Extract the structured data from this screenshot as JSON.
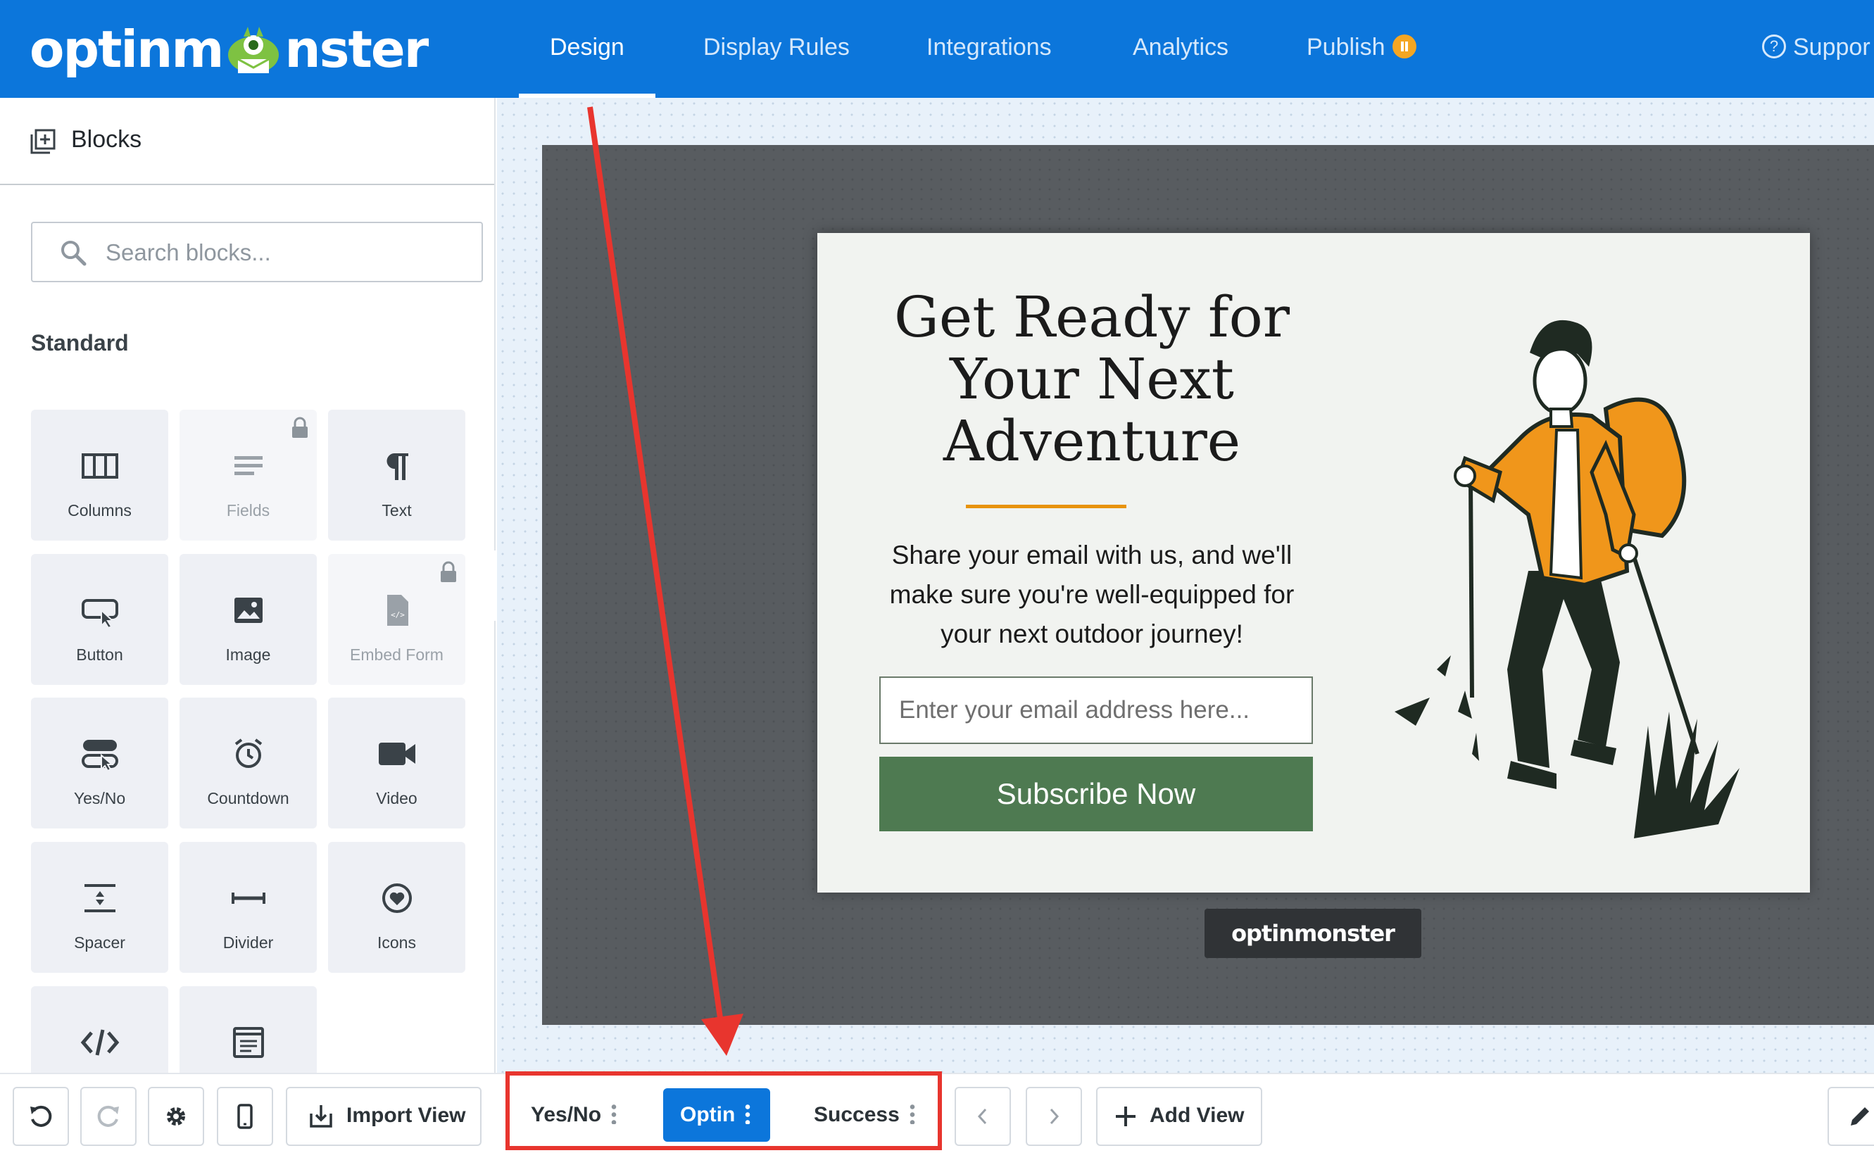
{
  "app": {
    "logo_text_left": "optinm",
    "logo_text_right": "nster"
  },
  "nav": {
    "design": "Design",
    "display_rules": "Display Rules",
    "integrations": "Integrations",
    "analytics": "Analytics",
    "publish": "Publish",
    "support": "Suppor",
    "active": "Design"
  },
  "sidebar": {
    "title": "Blocks",
    "search_placeholder": "Search blocks...",
    "section": "Standard",
    "blocks": [
      {
        "label": "Columns",
        "icon": "columns-icon",
        "locked": false
      },
      {
        "label": "Fields",
        "icon": "fields-icon",
        "locked": true
      },
      {
        "label": "Text",
        "icon": "paragraph-icon",
        "locked": false
      },
      {
        "label": "Button",
        "icon": "button-icon",
        "locked": false
      },
      {
        "label": "Image",
        "icon": "image-icon",
        "locked": false
      },
      {
        "label": "Embed Form",
        "icon": "embed-form-icon",
        "locked": true
      },
      {
        "label": "Yes/No",
        "icon": "yes-no-icon",
        "locked": false
      },
      {
        "label": "Countdown",
        "icon": "alarm-clock-icon",
        "locked": false
      },
      {
        "label": "Video",
        "icon": "video-camera-icon",
        "locked": false
      },
      {
        "label": "Spacer",
        "icon": "spacer-icon",
        "locked": false
      },
      {
        "label": "Divider",
        "icon": "divider-icon",
        "locked": false
      },
      {
        "label": "Icons",
        "icon": "heart-circle-icon",
        "locked": false
      },
      {
        "label": "",
        "icon": "code-icon",
        "locked": false
      },
      {
        "label": "",
        "icon": "form-icon",
        "locked": false
      }
    ]
  },
  "popup": {
    "headline_line1": "Get Ready for",
    "headline_line2": "Your Next",
    "headline_line3": "Adventure",
    "subtext": "Share your email with us, and we'll make sure you're well-equipped for your next outdoor journey!",
    "email_placeholder": "Enter your email address here...",
    "button_label": "Subscribe Now",
    "close_label": "×",
    "badge_text": "optinmonster"
  },
  "toolbar": {
    "import_view": "Import View",
    "views": [
      {
        "label": "Yes/No",
        "active": false
      },
      {
        "label": "Optin",
        "active": true
      },
      {
        "label": "Success",
        "active": false
      }
    ],
    "add_view": "Add View"
  },
  "colors": {
    "brand_blue": "#0c76db",
    "accent_orange": "#f0961b",
    "subscribe_green": "#4e7a51",
    "annotation_red": "#e8352e"
  }
}
